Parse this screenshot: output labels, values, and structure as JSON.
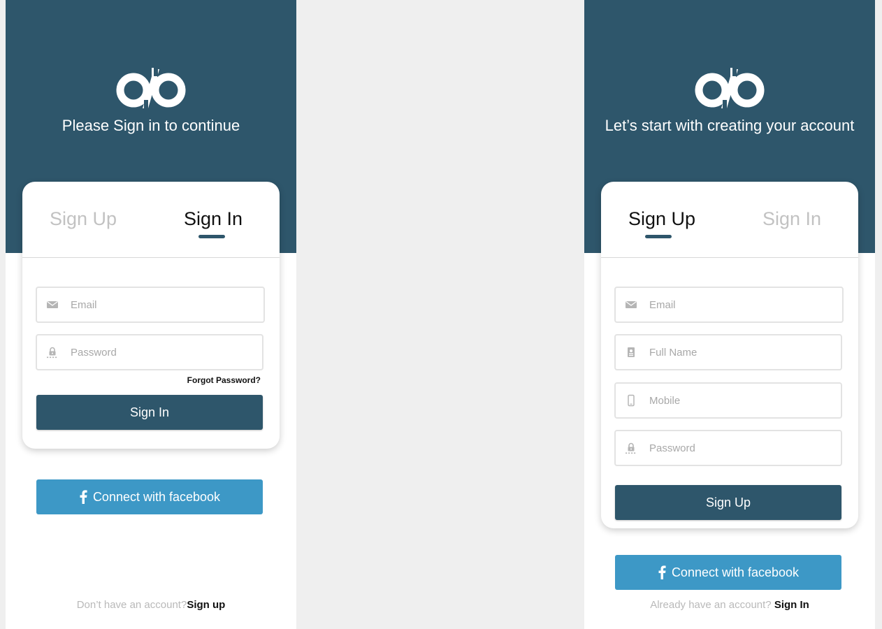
{
  "signin_screen": {
    "subtitle": "Please Sign in to continue",
    "tabs": {
      "signup": "Sign Up",
      "signin": "Sign In",
      "active": "signin"
    },
    "fields": {
      "email_placeholder": "Email",
      "password_placeholder": "Password"
    },
    "forgot_password": "Forgot Password?",
    "submit_label": "Sign In",
    "facebook_label": "Connect with facebook",
    "footer": {
      "text": "Don’t have an account?",
      "link": "Sign up"
    }
  },
  "signup_screen": {
    "subtitle": "Let’s start with creating your account",
    "tabs": {
      "signup": "Sign Up",
      "signin": "Sign In",
      "active": "signup"
    },
    "fields": {
      "email_placeholder": "Email",
      "fullname_placeholder": "Full Name",
      "mobile_placeholder": "Mobile",
      "password_placeholder": "Password"
    },
    "submit_label": "Sign Up",
    "facebook_label": "Connect with facebook",
    "footer": {
      "text": "Already have an account? ",
      "link": "Sign In"
    }
  },
  "icons": {
    "logo": "ab-logo",
    "email": "envelope-icon",
    "password": "lock-icon",
    "fullname": "id-card-icon",
    "mobile": "mobile-phone-icon",
    "facebook": "facebook-icon"
  },
  "colors": {
    "brand": "#2e566b",
    "facebook": "#3d98c6",
    "page_background": "#efefef",
    "inactive_tab": "#c2c2c2"
  }
}
